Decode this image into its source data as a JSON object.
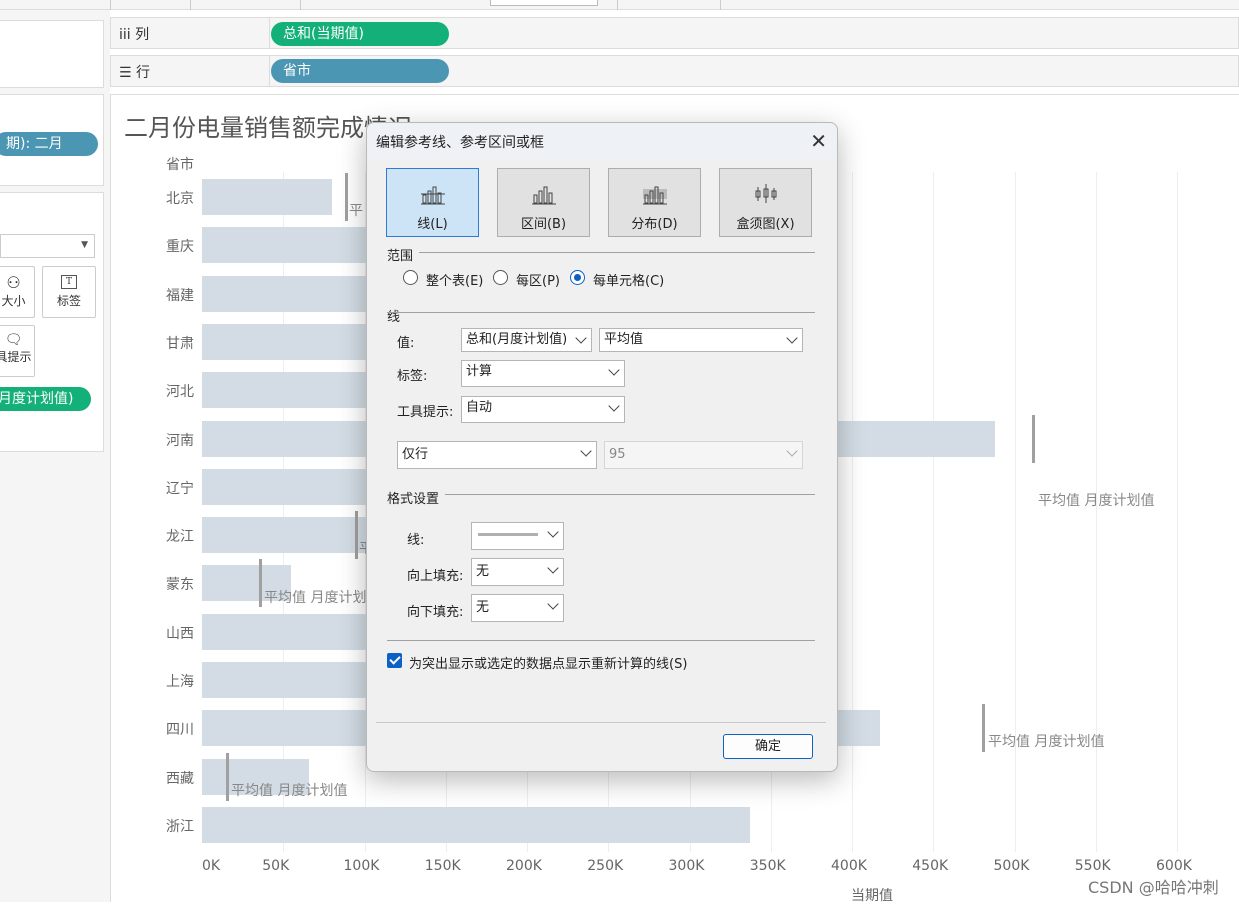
{
  "shelves": {
    "columns": {
      "label": "iii 列",
      "pill": "总和(当期值)"
    },
    "rows": {
      "label": "☰ 行",
      "pill": "省市"
    }
  },
  "left_panel": {
    "filter_pill": "期): 二月",
    "size_label": "大小",
    "label_label": "标签",
    "tooltip_label": "具提示",
    "measure_pill": "月度计划值)"
  },
  "chart": {
    "title": "二月份电量销售额完成情况",
    "row_header": "省市",
    "x_axis_title": "当期值",
    "ref_label": "平均值 月度计划值",
    "ref_label_partial": "平",
    "ref_label_short": "平均值 月度计划",
    "ref_label_partial2": "平均"
  },
  "chart_data": {
    "type": "bar",
    "orientation": "horizontal",
    "categories": [
      "北京",
      "重庆",
      "福建",
      "甘肃",
      "河北",
      "河南",
      "辽宁",
      "龙江",
      "蒙东",
      "山西",
      "上海",
      "四川",
      "西藏",
      "浙江"
    ],
    "values": [
      80000,
      null,
      null,
      null,
      null,
      488000,
      null,
      null,
      55000,
      null,
      null,
      417000,
      66000,
      337000
    ],
    "reference_values": [
      88000,
      null,
      null,
      null,
      null,
      511000,
      null,
      94000,
      35000,
      null,
      null,
      480000,
      15000,
      null
    ],
    "xlim": [
      0,
      630000
    ],
    "ticks": [
      "0K",
      "50K",
      "100K",
      "150K",
      "200K",
      "250K",
      "300K",
      "350K",
      "400K",
      "450K",
      "500K",
      "550K",
      "600K"
    ],
    "xlabel": "当期值",
    "ylabel": "省市",
    "title": "二月份电量销售额完成情况"
  },
  "dialog": {
    "title": "编辑参考线、参考区间或框",
    "close": "✕",
    "types": [
      "线(L)",
      "区间(B)",
      "分布(D)",
      "盒须图(X)"
    ],
    "scope": {
      "title": "范围",
      "options": [
        "整个表(E)",
        "每区(P)",
        "每单元格(C)"
      ]
    },
    "line": {
      "title": "线",
      "value_label": "值:",
      "value_field": "总和(月度计划值)",
      "aggregation": "平均值",
      "label_label": "标签:",
      "label_value": "计算",
      "tooltip_label": "工具提示:",
      "tooltip_value": "自动",
      "line_only": "仅行",
      "confidence": "95"
    },
    "format": {
      "title": "格式设置",
      "line_label": "线:",
      "fill_above_label": "向上填充:",
      "fill_above_value": "无",
      "fill_below_label": "向下填充:",
      "fill_below_value": "无"
    },
    "recalc_checkbox": "为突出显示或选定的数据点显示重新计算的线(S)",
    "ok": "确定"
  },
  "watermark": "CSDN @哈哈冲刺",
  "colors": {
    "pill_green": "#14b07a",
    "pill_blue": "#4a96b3",
    "bar": "#d3dce5",
    "accent": "#0b61c4"
  }
}
